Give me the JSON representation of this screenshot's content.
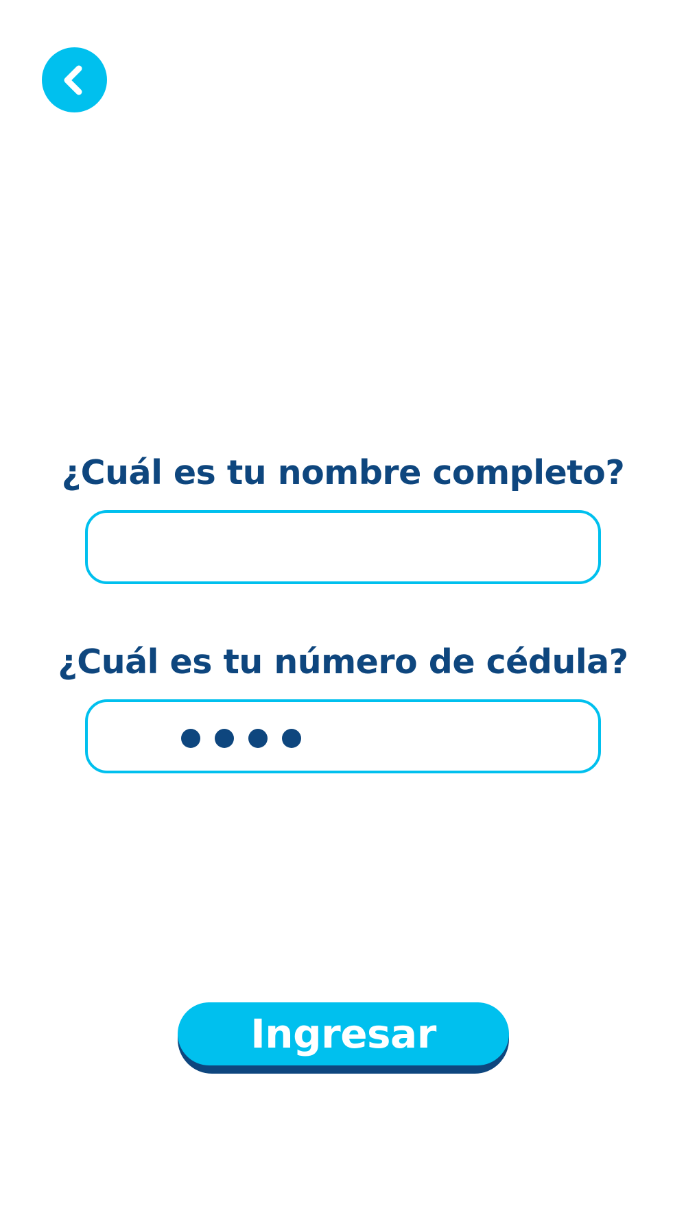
{
  "colors": {
    "accent": "#00c0ee",
    "text": "#0e467e",
    "background": "#ffffff",
    "button_shadow": "#0e467e"
  },
  "header": {
    "back_icon": "chevron-left-icon"
  },
  "form": {
    "name_label": "¿Cuál es tu nombre completo?",
    "name_value": "",
    "id_label": "¿Cuál es tu número de cédula?",
    "id_masked_digit_count": 4
  },
  "submit": {
    "label": "Ingresar"
  }
}
